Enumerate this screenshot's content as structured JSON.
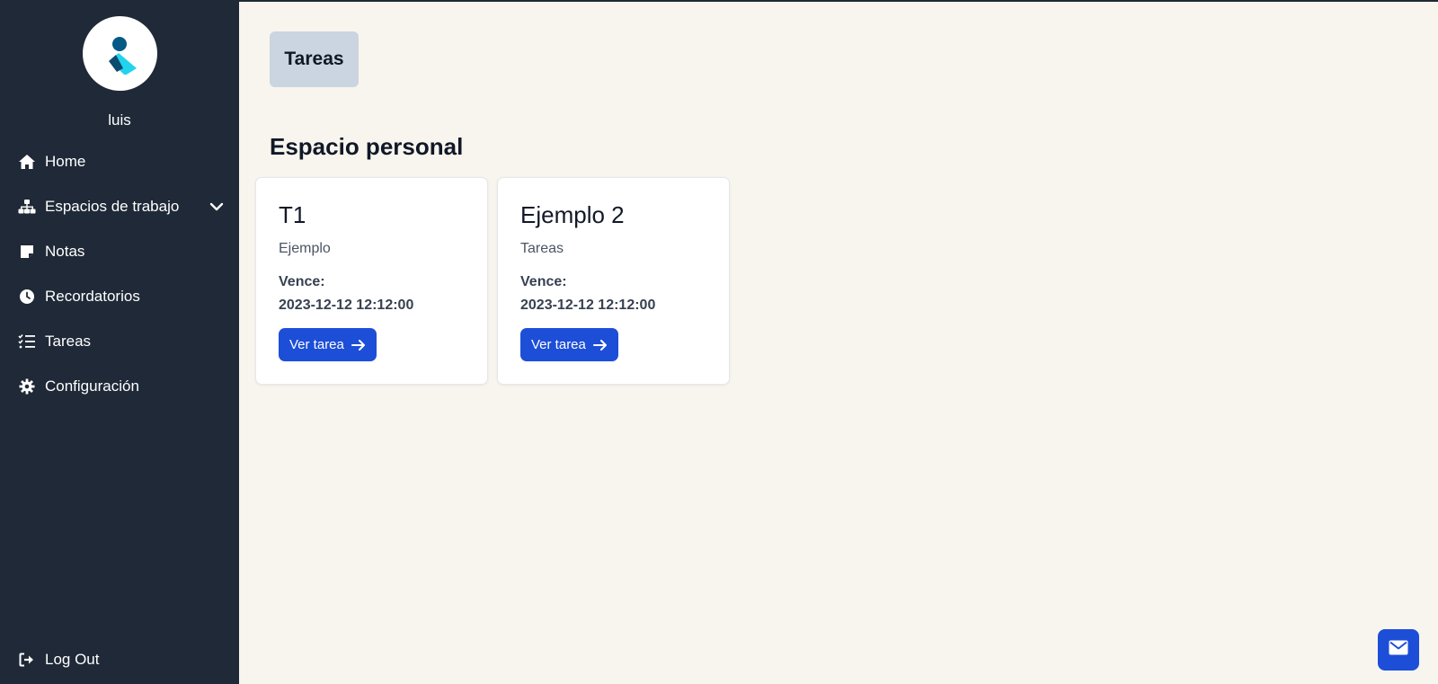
{
  "user": {
    "name": "luis"
  },
  "sidebar": {
    "items": [
      {
        "label": "Home",
        "icon": "home-icon"
      },
      {
        "label": "Espacios de trabajo",
        "icon": "sitemap-icon",
        "expandable": true
      },
      {
        "label": "Notas",
        "icon": "sticky-note-icon"
      },
      {
        "label": "Recordatorios",
        "icon": "clock-icon"
      },
      {
        "label": "Tareas",
        "icon": "task-list-icon"
      },
      {
        "label": "Configuración",
        "icon": "gear-icon"
      }
    ],
    "logout_label": "Log Out"
  },
  "main": {
    "tab_label": "Tareas",
    "section_title": "Espacio personal",
    "cards": [
      {
        "title": "T1",
        "subtitle": "Ejemplo",
        "due_label": "Vence:",
        "due_date": "2023-12-12 12:12:00",
        "button_label": "Ver tarea"
      },
      {
        "title": "Ejemplo 2",
        "subtitle": "Tareas",
        "due_label": "Vence:",
        "due_date": "2023-12-12 12:12:00",
        "button_label": "Ver tarea"
      }
    ]
  },
  "colors": {
    "sidebar_bg": "#1f2937",
    "page_bg": "#f8f5ee",
    "accent": "#1d4ed8",
    "tab_chip_bg": "#cbd5e1"
  }
}
